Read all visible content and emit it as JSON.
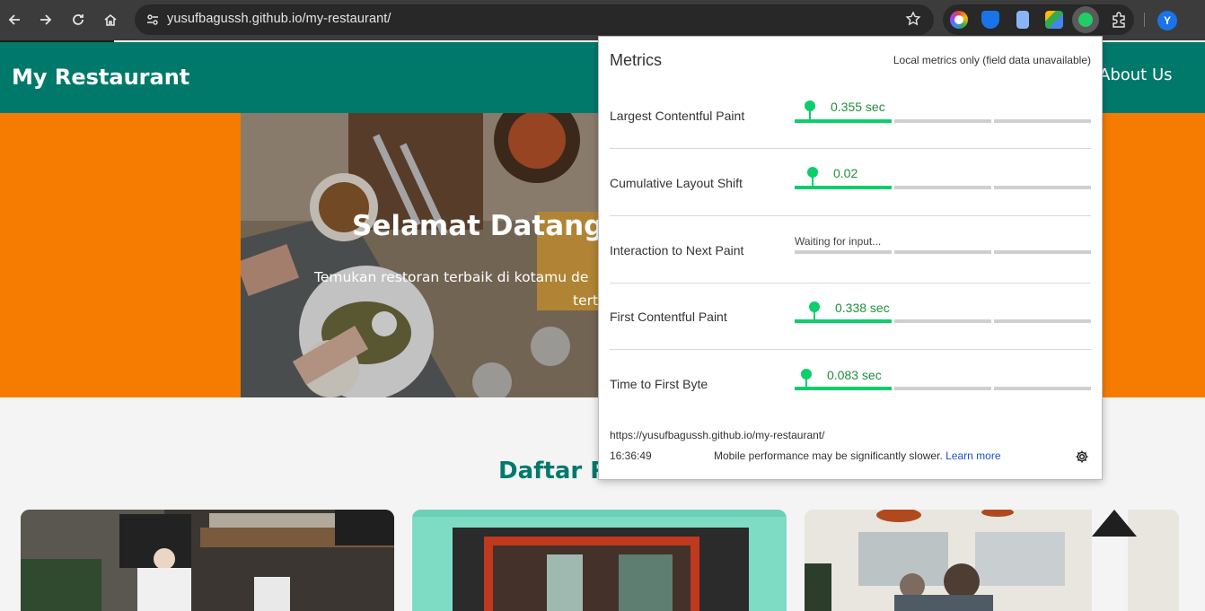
{
  "browser": {
    "url": "yusufbagussh.github.io/my-restaurant/",
    "profile_initial": "Y",
    "icons": [
      "back-icon",
      "forward-icon",
      "reload-icon",
      "home-icon",
      "site-info-icon",
      "star-icon",
      "extensions-icon"
    ]
  },
  "site": {
    "brand": "My Restaurant",
    "nav_about": "About Us",
    "hero_title": "Selamat Datang",
    "hero_subtitle_line1": "Temukan restoran terbaik di kotamu de",
    "hero_subtitle_line2": "tert",
    "section_title": "Daftar Restoran",
    "colors": {
      "header": "#00796b",
      "hero": "#f57c00"
    }
  },
  "metrics_popup": {
    "title": "Metrics",
    "note": "Local metrics only (field data unavailable)",
    "metrics": [
      {
        "label": "Largest Contentful Paint",
        "value": "0.355 sec",
        "status": "good"
      },
      {
        "label": "Cumulative Layout Shift",
        "value": "0.02",
        "status": "good"
      },
      {
        "label": "Interaction to Next Paint",
        "value": "Waiting for input...",
        "status": "waiting"
      },
      {
        "label": "First Contentful Paint",
        "value": "0.338 sec",
        "status": "good"
      },
      {
        "label": "Time to First Byte",
        "value": "0.083 sec",
        "status": "good"
      }
    ],
    "url": "https://yusufbagussh.github.io/my-restaurant/",
    "time": "16:36:49",
    "mobile_note": "Mobile performance may be significantly slower.",
    "learn_more": "Learn more",
    "good_color": "#0cce6b"
  }
}
